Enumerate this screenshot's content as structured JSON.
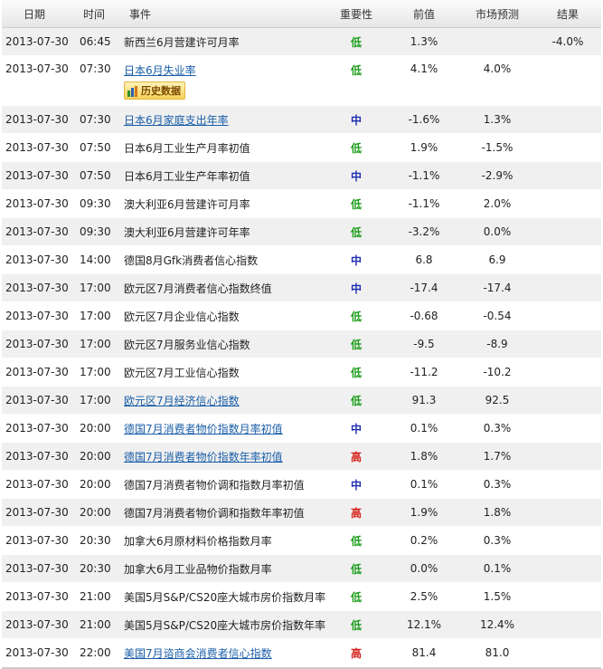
{
  "headers": {
    "date": "日期",
    "time": "时间",
    "event": "事件",
    "importance": "重要性",
    "previous": "前值",
    "forecast": "市场预测",
    "result": "结果"
  },
  "history_label": "历史数据",
  "colors": {
    "low": "#1a9c1a",
    "mid": "#1f2fb0",
    "high": "#d4201a",
    "link": "#1a5ea8"
  },
  "rows": [
    {
      "date": "2013-07-30",
      "time": "06:45",
      "event": "新西兰6月营建许可月率",
      "link": false,
      "imp": "低",
      "level": "low",
      "prev": "1.3%",
      "forecast": "",
      "result": "-4.0%"
    },
    {
      "date": "2013-07-30",
      "time": "07:30",
      "event": "日本6月失业率",
      "link": true,
      "imp": "低",
      "level": "low",
      "prev": "4.1%",
      "forecast": "4.0%",
      "result": "",
      "history": true
    },
    {
      "date": "2013-07-30",
      "time": "07:30",
      "event": "日本6月家庭支出年率",
      "link": true,
      "imp": "中",
      "level": "mid",
      "prev": "-1.6%",
      "forecast": "1.3%",
      "result": ""
    },
    {
      "date": "2013-07-30",
      "time": "07:50",
      "event": "日本6月工业生产月率初值",
      "link": false,
      "imp": "低",
      "level": "low",
      "prev": "1.9%",
      "forecast": "-1.5%",
      "result": ""
    },
    {
      "date": "2013-07-30",
      "time": "07:50",
      "event": "日本6月工业生产年率初值",
      "link": false,
      "imp": "中",
      "level": "mid",
      "prev": "-1.1%",
      "forecast": "-2.9%",
      "result": ""
    },
    {
      "date": "2013-07-30",
      "time": "09:30",
      "event": "澳大利亚6月营建许可月率",
      "link": false,
      "imp": "低",
      "level": "low",
      "prev": "-1.1%",
      "forecast": "2.0%",
      "result": ""
    },
    {
      "date": "2013-07-30",
      "time": "09:30",
      "event": "澳大利亚6月营建许可年率",
      "link": false,
      "imp": "低",
      "level": "low",
      "prev": "-3.2%",
      "forecast": "0.0%",
      "result": ""
    },
    {
      "date": "2013-07-30",
      "time": "14:00",
      "event": "德国8月Gfk消费者信心指数",
      "link": false,
      "imp": "中",
      "level": "mid",
      "prev": "6.8",
      "forecast": "6.9",
      "result": ""
    },
    {
      "date": "2013-07-30",
      "time": "17:00",
      "event": "欧元区7月消费者信心指数终值",
      "link": false,
      "imp": "中",
      "level": "mid",
      "prev": "-17.4",
      "forecast": "-17.4",
      "result": ""
    },
    {
      "date": "2013-07-30",
      "time": "17:00",
      "event": "欧元区7月企业信心指数",
      "link": false,
      "imp": "低",
      "level": "low",
      "prev": "-0.68",
      "forecast": "-0.54",
      "result": ""
    },
    {
      "date": "2013-07-30",
      "time": "17:00",
      "event": "欧元区7月服务业信心指数",
      "link": false,
      "imp": "低",
      "level": "low",
      "prev": "-9.5",
      "forecast": "-8.9",
      "result": ""
    },
    {
      "date": "2013-07-30",
      "time": "17:00",
      "event": "欧元区7月工业信心指数",
      "link": false,
      "imp": "低",
      "level": "low",
      "prev": "-11.2",
      "forecast": "-10.2",
      "result": ""
    },
    {
      "date": "2013-07-30",
      "time": "17:00",
      "event": "欧元区7月经济信心指数",
      "link": true,
      "imp": "低",
      "level": "low",
      "prev": "91.3",
      "forecast": "92.5",
      "result": ""
    },
    {
      "date": "2013-07-30",
      "time": "20:00",
      "event": "德国7月消费者物价指数月率初值",
      "link": true,
      "imp": "中",
      "level": "mid",
      "prev": "0.1%",
      "forecast": "0.3%",
      "result": ""
    },
    {
      "date": "2013-07-30",
      "time": "20:00",
      "event": "德国7月消费者物价指数年率初值",
      "link": true,
      "imp": "高",
      "level": "high",
      "prev": "1.8%",
      "forecast": "1.7%",
      "result": ""
    },
    {
      "date": "2013-07-30",
      "time": "20:00",
      "event": "德国7月消费者物价调和指数月率初值",
      "link": false,
      "imp": "中",
      "level": "mid",
      "prev": "0.1%",
      "forecast": "0.3%",
      "result": ""
    },
    {
      "date": "2013-07-30",
      "time": "20:00",
      "event": "德国7月消费者物价调和指数年率初值",
      "link": false,
      "imp": "高",
      "level": "high",
      "prev": "1.9%",
      "forecast": "1.8%",
      "result": ""
    },
    {
      "date": "2013-07-30",
      "time": "20:30",
      "event": "加拿大6月原材料价格指数月率",
      "link": false,
      "imp": "低",
      "level": "low",
      "prev": "0.2%",
      "forecast": "0.3%",
      "result": ""
    },
    {
      "date": "2013-07-30",
      "time": "20:30",
      "event": "加拿大6月工业品物价指数月率",
      "link": false,
      "imp": "低",
      "level": "low",
      "prev": "0.0%",
      "forecast": "0.1%",
      "result": ""
    },
    {
      "date": "2013-07-30",
      "time": "21:00",
      "event": "美国5月S&P/CS20座大城市房价指数月率",
      "link": false,
      "imp": "低",
      "level": "low",
      "prev": "2.5%",
      "forecast": "1.5%",
      "result": ""
    },
    {
      "date": "2013-07-30",
      "time": "21:00",
      "event": "美国5月S&P/CS20座大城市房价指数年率",
      "link": false,
      "imp": "低",
      "level": "low",
      "prev": "12.1%",
      "forecast": "12.4%",
      "result": ""
    },
    {
      "date": "2013-07-30",
      "time": "22:00",
      "event": "美国7月谘商会消费者信心指数",
      "link": true,
      "imp": "高",
      "level": "high",
      "prev": "81.4",
      "forecast": "81.0",
      "result": ""
    }
  ]
}
